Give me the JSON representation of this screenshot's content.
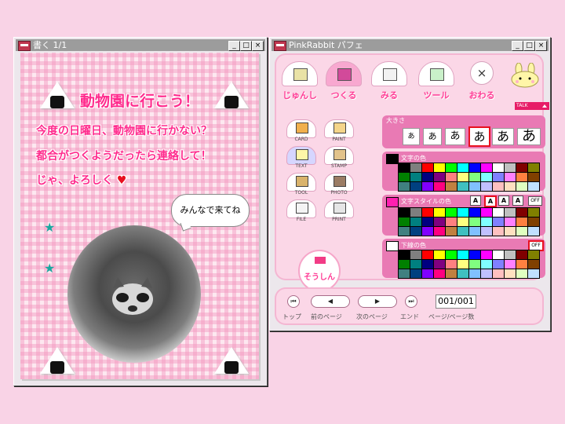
{
  "left_window": {
    "title": "書く 1/1",
    "paper": {
      "title": "動物園に行こう！",
      "lines": [
        "今度の日曜日、動物園に行かない？",
        "都合がつくようだったら連絡して！",
        "じゃ、よろしく"
      ],
      "heart": "♥",
      "star": "★",
      "bubble": "みんなで来てね"
    }
  },
  "right_window": {
    "title": "PinkRabbit パフェ",
    "top_buttons": [
      "じゅんし",
      "つくる",
      "みる",
      "ツール",
      "おわる"
    ],
    "close_glyph": "×",
    "talk_label": "TALK",
    "tools": [
      "CARD",
      "PAINT",
      "TEXT",
      "STAMP",
      "TOOL",
      "PHOTO",
      "FILE",
      "PRINT"
    ],
    "send_label": "そうしん",
    "size_label": "大きさ",
    "size_glyph": "あ",
    "text_color_label": "文字の色",
    "text_style_label": "文字スタイルの色",
    "style_glyph": "A",
    "underline_label": "下線の色",
    "off_label": "OFF",
    "nav": {
      "labels": [
        "トップ",
        "前のページ",
        "次のページ",
        "エンド",
        "ページ/ページ数"
      ],
      "page_display": "001/001",
      "first_glyph": "⏮",
      "prev_glyph": "◀",
      "next_glyph": "▶",
      "last_glyph": "⏭"
    }
  },
  "colors": {
    "palette": [
      "#000000",
      "#7f7f7f",
      "#ff0000",
      "#ffff00",
      "#00ff00",
      "#00ffff",
      "#0000ff",
      "#ff00ff",
      "#ffffff",
      "#c0c0c0",
      "#800000",
      "#808000",
      "#008000",
      "#008080",
      "#000080",
      "#800080",
      "#ff8080",
      "#ffff80",
      "#80ff80",
      "#80ffff",
      "#8080ff",
      "#ff80ff",
      "#ff8040",
      "#804000",
      "#408080",
      "#004080",
      "#8000ff",
      "#ff0080",
      "#c08040",
      "#40c0c0",
      "#80c0ff",
      "#c0c0ff",
      "#ffc0c0",
      "#ffe0c0",
      "#e0ffc0",
      "#c0e0ff"
    ],
    "accent": "#ff2b8d"
  }
}
